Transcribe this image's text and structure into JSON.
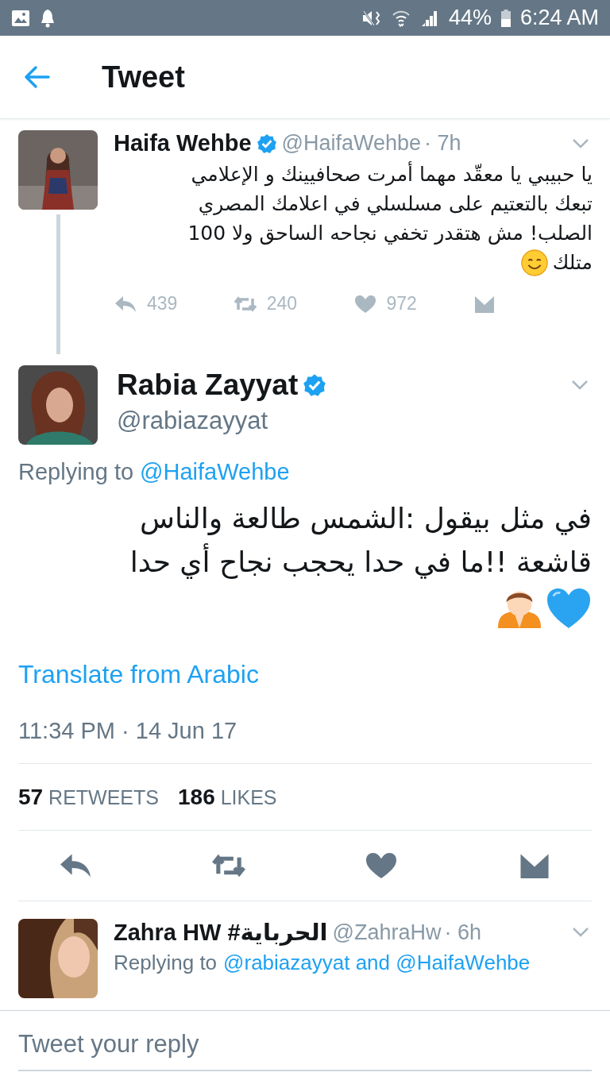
{
  "status_bar": {
    "battery": "44%",
    "time": "6:24 AM"
  },
  "header": {
    "title": "Tweet"
  },
  "parent_tweet": {
    "name": "Haifa Wehbe",
    "verified": true,
    "handle": "@HaifaWehbe",
    "time": "· 7h",
    "text_lines": [
      "يا حبيبي يا معقّد مهما أمرت صحافيينك و الإعلامي",
      "تبعك بالتعتيم على مسلسلي في اعلامك المصري",
      "الصلب!  مش هتقدر تخفي نجاحه الساحق  ولا 100",
      "متلك"
    ],
    "actions": [
      {
        "kind": "reply",
        "count": "439"
      },
      {
        "kind": "retweet",
        "count": "240"
      },
      {
        "kind": "like",
        "count": "972"
      },
      {
        "kind": "message"
      }
    ]
  },
  "main_tweet": {
    "name": "Rabia Zayyat",
    "verified": true,
    "handle": "@rabiazayyat",
    "replying_label": "Replying to",
    "replying_to": "@HaifaWehbe",
    "text_lines": [
      "في مثل بيقول :الشمس طالعة والناس",
      "قاشعة !!ما في حدا يحجب نجاح أي حدا"
    ],
    "translate": "Translate from Arabic",
    "timestamp": "11:34 PM · 14 Jun 17",
    "stats": [
      {
        "count": "57",
        "label": "RETWEETS"
      },
      {
        "count": "186",
        "label": "LIKES"
      }
    ],
    "actions": [
      {
        "kind": "reply"
      },
      {
        "kind": "retweet"
      },
      {
        "kind": "like"
      },
      {
        "kind": "message"
      }
    ]
  },
  "reply": {
    "name": "Zahra HW #الحرباية",
    "handle": "@ZahraHw",
    "time": "· 6h",
    "replying_label": "Replying to",
    "replying_to": "@rabiazayyat and @HaifaWehbe"
  },
  "compose": {
    "placeholder": "Tweet your reply"
  }
}
